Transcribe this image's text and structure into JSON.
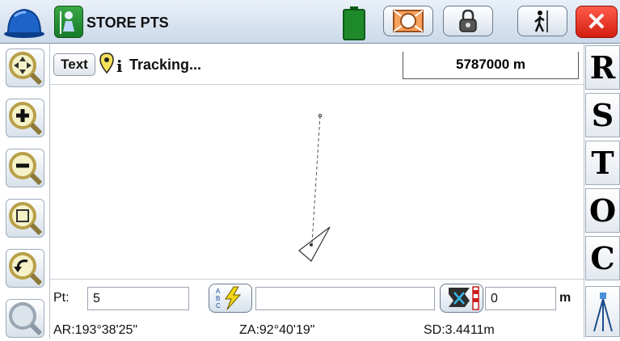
{
  "app": {
    "title": "STORE PTS"
  },
  "map_header": {
    "text_button": "Text",
    "status": "Tracking...",
    "scale": "5787000 m"
  },
  "right_toolbar": {
    "letters": [
      "R",
      "S",
      "T",
      "O",
      "C"
    ]
  },
  "point": {
    "label": "Pt:",
    "value": "5",
    "description": "",
    "height": "0",
    "height_unit": "m"
  },
  "readouts": {
    "ar": "AR:193°38'25\"",
    "za": "ZA:92°40'19\"",
    "sd": "SD:3.4411m"
  },
  "colors": {
    "close": "#d31e10",
    "battery": "#1f8a2a",
    "orange": "#e2742a"
  },
  "icons": {
    "helmet": "helmet-icon",
    "store": "surveyor-icon",
    "battery": "battery-icon",
    "target": "target-icon",
    "lock": "lock-icon",
    "walker": "walker-icon",
    "close": "close-icon",
    "pan": "pan-icon",
    "zoom_in": "zoom-in-icon",
    "zoom_out": "zoom-out-icon",
    "zoom_extents": "zoom-extents-icon",
    "zoom_previous": "zoom-previous-icon",
    "info": "point-info-icon",
    "abc": "abc-lightning-icon",
    "hr": "target-height-icon",
    "tripod": "tripod-icon"
  }
}
